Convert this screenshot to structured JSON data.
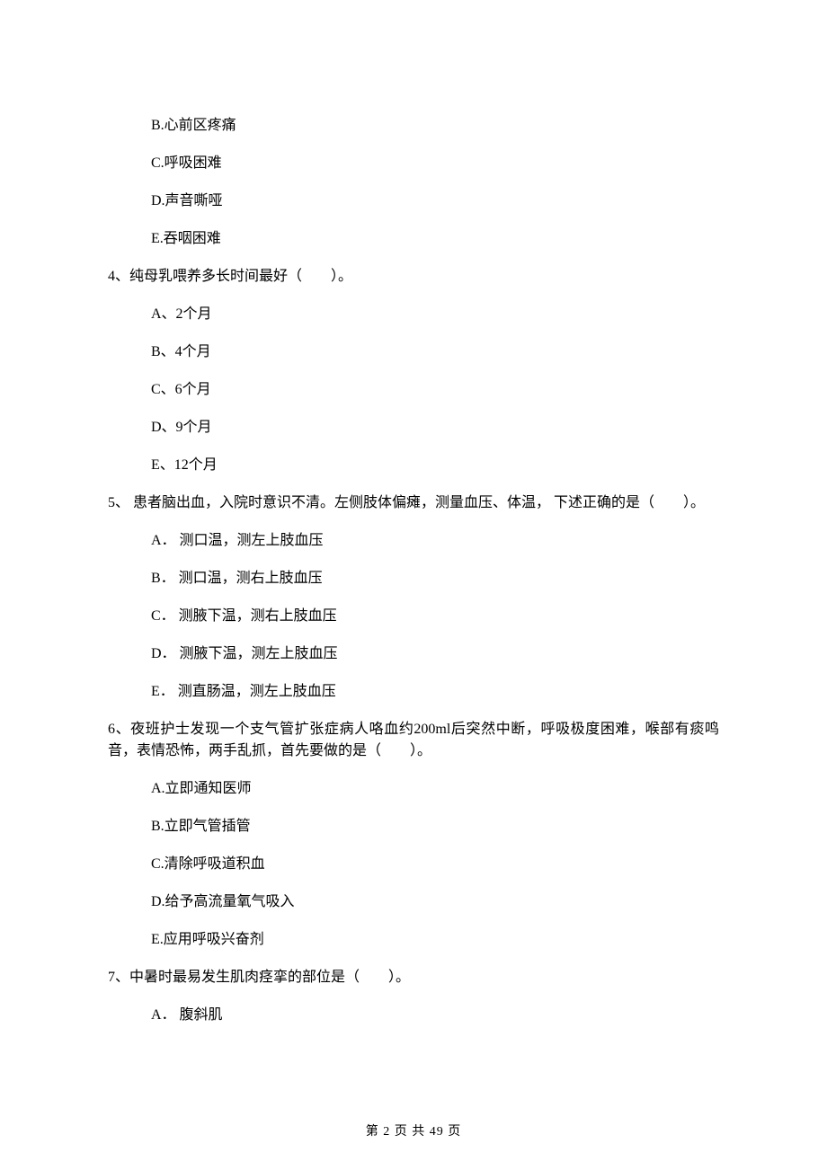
{
  "options_leading": [
    "B.心前区疼痛",
    "C.呼吸困难",
    "D.声音嘶哑",
    "E.吞咽困难"
  ],
  "q4": {
    "text": "4、纯母乳喂养多长时间最好（　　）。",
    "options": [
      "A、2个月",
      "B、4个月",
      "C、6个月",
      "D、9个月",
      "E、12个月"
    ]
  },
  "q5": {
    "text": "5、 患者脑出血，入院时意识不清。左侧肢体偏瘫，测量血压、体温， 下述正确的是（　　）。",
    "options": [
      "A． 测口温，测左上肢血压",
      "B． 测口温，测右上肢血压",
      "C． 测腋下温，测右上肢血压",
      "D． 测腋下温，测左上肢血压",
      "E． 测直肠温，测左上肢血压"
    ]
  },
  "q6": {
    "text": "6、夜班护士发现一个支气管扩张症病人咯血约200ml后突然中断，呼吸极度困难，喉部有痰鸣音，表情恐怖，两手乱抓，首先要做的是（　　）。",
    "options": [
      "A.立即通知医师",
      "B.立即气管插管",
      "C.清除呼吸道积血",
      "D.给予高流量氧气吸入",
      "E.应用呼吸兴奋剂"
    ]
  },
  "q7": {
    "text": "7、中暑时最易发生肌肉痉挛的部位是（　　）。",
    "options": [
      "A． 腹斜肌"
    ]
  },
  "footer": "第 2 页 共 49 页"
}
